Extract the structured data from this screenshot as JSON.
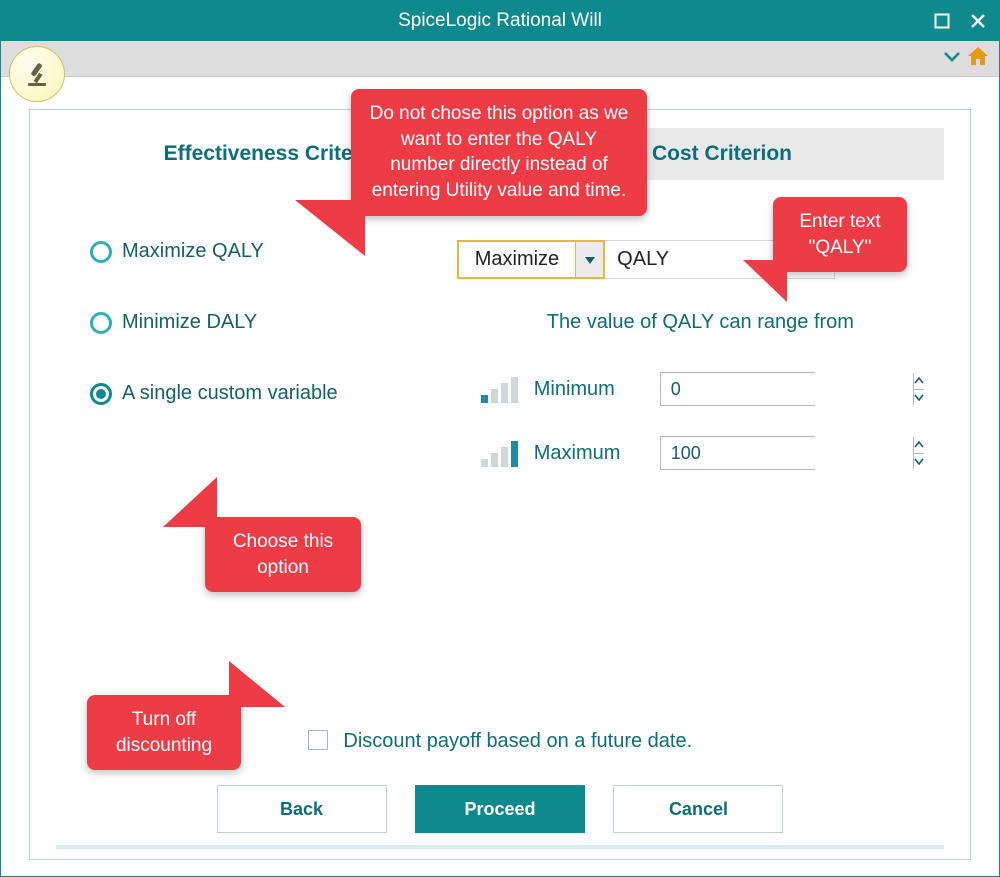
{
  "window": {
    "title": "SpiceLogic Rational Will"
  },
  "tabs": {
    "effectiveness": "Effectiveness Criterion",
    "cost": "Cost Criterion"
  },
  "radios": {
    "maximize_qaly": "Maximize QALY",
    "minimize_daly": "Minimize DALY",
    "single_custom": "A single custom variable"
  },
  "combo": {
    "selected": "Maximize",
    "input_value": "QALY"
  },
  "range": {
    "header": "The value of QALY can range from",
    "min_label": "Minimum",
    "min_value": "0",
    "max_label": "Maximum",
    "max_value": "100"
  },
  "discount": {
    "label": "Discount payoff based on a future date."
  },
  "buttons": {
    "back": "Back",
    "proceed": "Proceed",
    "cancel": "Cancel"
  },
  "callouts": {
    "c1": "Do not chose this option as we want to enter the QALY number directly instead of entering Utility value and time.",
    "c2": "Enter text \"QALY\"",
    "c3": "Choose this option",
    "c4": "Turn off discounting"
  }
}
